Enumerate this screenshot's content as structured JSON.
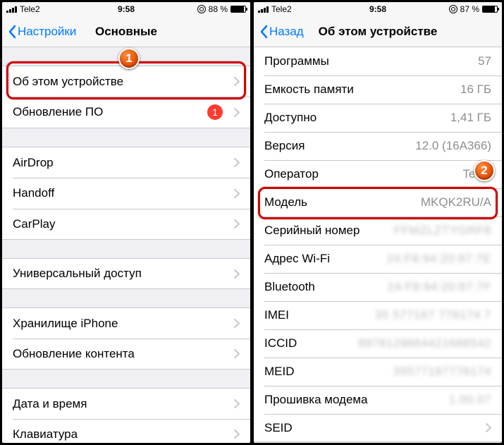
{
  "phone1": {
    "status": {
      "carrier": "Tele2",
      "time": "9:58",
      "battery_pct": "88 %",
      "battery_fill": 88
    },
    "nav": {
      "back": "Настройки",
      "title": "Основные"
    },
    "group1": [
      {
        "label": "Об этом устройстве",
        "badge": null
      },
      {
        "label": "Обновление ПО",
        "badge": "1"
      }
    ],
    "group2": [
      {
        "label": "AirDrop"
      },
      {
        "label": "Handoff"
      },
      {
        "label": "CarPlay"
      }
    ],
    "group3": [
      {
        "label": "Универсальный доступ"
      }
    ],
    "group4": [
      {
        "label": "Хранилище iPhone"
      },
      {
        "label": "Обновление контента"
      }
    ],
    "group5": [
      {
        "label": "Дата и время"
      },
      {
        "label": "Клавиатура"
      }
    ],
    "marker": "1"
  },
  "phone2": {
    "status": {
      "carrier": "Tele2",
      "time": "9:58",
      "battery_pct": "87 %",
      "battery_fill": 87
    },
    "nav": {
      "back": "Назад",
      "title": "Об этом устройстве"
    },
    "rows": [
      {
        "label": "Программы",
        "value": "57",
        "blur": false
      },
      {
        "label": "Емкость памяти",
        "value": "16 ГБ",
        "blur": false
      },
      {
        "label": "Доступно",
        "value": "1,41 ГБ",
        "blur": false
      },
      {
        "label": "Версия",
        "value": "12.0 (16A366)",
        "blur": false
      },
      {
        "label": "Оператор",
        "value": "Tele2",
        "blur": false
      },
      {
        "label": "Модель",
        "value": "MKQK2RU/A",
        "blur": false
      },
      {
        "label": "Серийный номер",
        "value": "FFMZLZTYGRF8",
        "blur": true
      },
      {
        "label": "Адрес Wi-Fi",
        "value": "24:F8:94:20:87:7E",
        "blur": true
      },
      {
        "label": "Bluetooth",
        "value": "24:F8:94:20:87:7F",
        "blur": true
      },
      {
        "label": "IMEI",
        "value": "35 577187 778174 7",
        "blur": true
      },
      {
        "label": "ICCID",
        "value": "8978129864421688542",
        "blur": true
      },
      {
        "label": "MEID",
        "value": "35577187778174",
        "blur": true
      },
      {
        "label": "Прошивка модема",
        "value": "1.00.07",
        "blur": true
      },
      {
        "label": "SEID",
        "value": "",
        "blur": false,
        "chevron": true
      }
    ],
    "marker": "2"
  }
}
